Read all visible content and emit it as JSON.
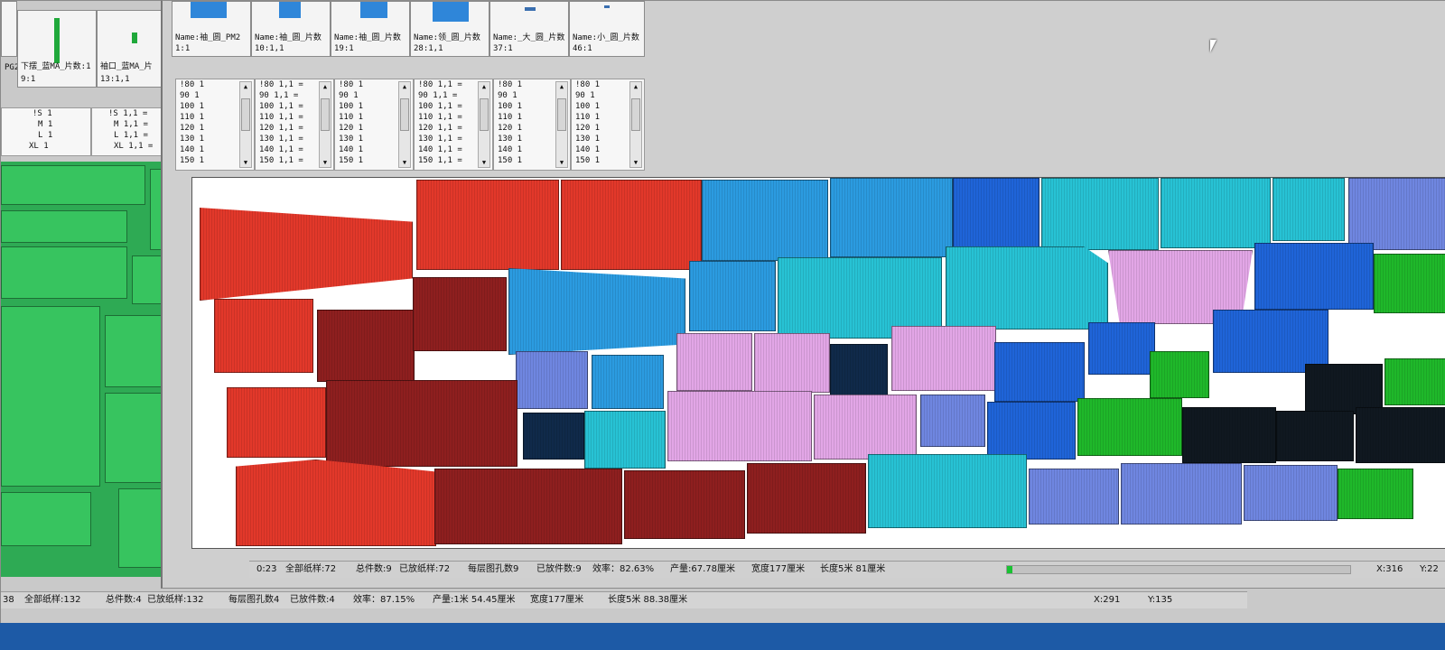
{
  "back_window": {
    "thumbs": [
      {
        "name": "PG2",
        "id": "="
      },
      {
        "name": "下摆_蓝MA_片数:1",
        "id": "9:1"
      },
      {
        "name": "袖口_蓝MA_片",
        "id": "13:1,1"
      }
    ],
    "sizes_a": [
      "!S 1",
      "M 1",
      "L 1",
      "XL 1"
    ],
    "sizes_b": [
      "!S 1,1 =",
      "M 1,1 =",
      "L 1,1 =",
      "XL 1,1 ="
    ],
    "status": {
      "time": "38",
      "all_samples": "全部纸样:132",
      "total_pieces": "总件数:4",
      "placed_samples": "已放纸样:132",
      "layer_holes": "每层图孔数4",
      "placed_pieces": "已放件数:4",
      "efficiency": "效率：87.15%",
      "yield": "产量:1米 54.45厘米",
      "width": "宽度177厘米",
      "length": "长度5米 88.38厘米",
      "coord_x": "X:291",
      "coord_y": "Y:135"
    }
  },
  "front_window": {
    "thumbs": [
      {
        "name": "Name:袖_圆_PM2",
        "id": "1:1"
      },
      {
        "name": "Name:袖_圆_片数",
        "id": "10:1,1"
      },
      {
        "name": "Name:袖_圆_片数",
        "id": "19:1"
      },
      {
        "name": "Name:领_圆_片数",
        "id": "28:1,1"
      },
      {
        "name": "Name:_大_圆_片数",
        "id": "37:1"
      },
      {
        "name": "Name:小_圆_片数",
        "id": "46:1"
      }
    ],
    "size_lists": [
      [
        "!80 1",
        "90 1",
        "100 1",
        "110 1",
        "120 1",
        "130 1",
        "140 1",
        "150 1"
      ],
      [
        "!80 1,1 =",
        "90 1,1 =",
        "100 1,1 =",
        "110 1,1 =",
        "120 1,1 =",
        "130 1,1 =",
        "140 1,1 =",
        "150 1,1 ="
      ],
      [
        "!80 1",
        "90 1",
        "100 1",
        "110 1",
        "120 1",
        "130 1",
        "140 1",
        "150 1"
      ],
      [
        "!80 1,1 =",
        "90 1,1 =",
        "100 1,1 =",
        "110 1,1 =",
        "120 1,1 =",
        "130 1,1 =",
        "140 1,1 =",
        "150 1,1 ="
      ],
      [
        "!80 1",
        "90 1",
        "100 1",
        "110 1",
        "120 1",
        "130 1",
        "140 1",
        "150 1"
      ],
      [
        "!80 1",
        "90 1",
        "100 1",
        "110 1",
        "120 1",
        "130 1",
        "140 1",
        "150 1"
      ]
    ],
    "status": {
      "time": "0:23",
      "all_samples": "全部纸样:72",
      "total_pieces": "总件数:9",
      "placed_samples": "已放纸样:72",
      "layer_holes": "每层图孔数9",
      "placed_pieces": "已放件数:9",
      "efficiency": "效率：82.63%",
      "yield": "产量:67.78厘米",
      "width": "宽度177厘米",
      "length": "长度5米 81厘米",
      "coord_x": "X:316",
      "coord_y": "Y:22"
    }
  },
  "colors": {
    "red": "#e2382a",
    "dark_red": "#8e1f1f",
    "sky_blue": "#2b9be0",
    "cyan": "#27c2d4",
    "pink": "#e2a6e6",
    "royal_blue": "#1f64d8",
    "periwinkle": "#6f86e0",
    "navy": "#102a4a",
    "green": "#1fb82a",
    "black": "#101820"
  }
}
